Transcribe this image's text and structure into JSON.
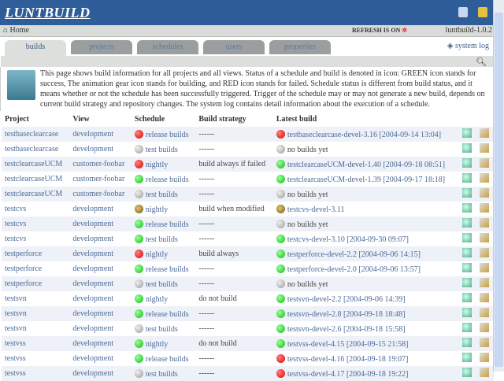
{
  "app": {
    "title": "LUNTBUILD",
    "version": "luntbuild-1.0.2",
    "refresh": "REFRESH IS ON",
    "home": "Home"
  },
  "tabs": [
    {
      "label": "builds"
    },
    {
      "label": "projects"
    },
    {
      "label": "schedules"
    },
    {
      "label": "users"
    },
    {
      "label": "properties"
    }
  ],
  "system_log": "system log",
  "description": "This page shows build information for all projects and all views. Status of a schedule and build is denoted in icon: GREEN icon stands for success, The animation gear icon stands for building, and RED icon stands for failed. Schedule status is different from build status, and it means whether or not the schedule has been successfully triggered. Trigger of the schedule may or may not generate a new build, depends on current build strategy and repository changes. The system log contains detail information about the execution of a schedule.",
  "columns": [
    "Project",
    "View",
    "Schedule",
    "Build strategy",
    "Latest build"
  ],
  "rows": [
    {
      "project": "testbaseclearcase",
      "view": "development",
      "sched_status": "red",
      "schedule": "release builds",
      "strategy": "------",
      "build_status": "red",
      "build": "testbaseclearcase-devel-3.16 [2004-09-14 13:04]"
    },
    {
      "project": "testbaseclearcase",
      "view": "development",
      "sched_status": "grey",
      "schedule": "test builds",
      "strategy": "------",
      "build_status": "grey",
      "build": "no builds yet"
    },
    {
      "project": "testclearcaseUCM",
      "view": "customer-foobar",
      "sched_status": "red",
      "schedule": "nightly",
      "strategy": "build always if failed",
      "build_status": "green",
      "build": "testclearcaseUCM-devel-1.40 [2004-09-18 08:51]"
    },
    {
      "project": "testclearcaseUCM",
      "view": "customer-foobar",
      "sched_status": "green",
      "schedule": "release builds",
      "strategy": "------",
      "build_status": "green",
      "build": "testclearcaseUCM-devel-1.39 [2004-09-17 18:18]"
    },
    {
      "project": "testclearcaseUCM",
      "view": "customer-foobar",
      "sched_status": "grey",
      "schedule": "test builds",
      "strategy": "------",
      "build_status": "grey",
      "build": "no builds yet"
    },
    {
      "project": "testcvs",
      "view": "development",
      "sched_status": "gear",
      "schedule": "nightly",
      "strategy": "build when modified",
      "build_status": "gear",
      "build": "testcvs-devel-3.11"
    },
    {
      "project": "testcvs",
      "view": "development",
      "sched_status": "green",
      "schedule": "release builds",
      "strategy": "------",
      "build_status": "grey",
      "build": "no builds yet"
    },
    {
      "project": "testcvs",
      "view": "development",
      "sched_status": "green",
      "schedule": "test builds",
      "strategy": "------",
      "build_status": "green",
      "build": "testcvs-devel-3.10 [2004-09-30 09:07]"
    },
    {
      "project": "testperforce",
      "view": "development",
      "sched_status": "red",
      "schedule": "nightly",
      "strategy": "build always",
      "build_status": "green",
      "build": "testperforce-devel-2.2 [2004-09-06 14:15]"
    },
    {
      "project": "testperforce",
      "view": "development",
      "sched_status": "green",
      "schedule": "release builds",
      "strategy": "------",
      "build_status": "green",
      "build": "testperforce-devel-2.0 [2004-09-06 13:57]"
    },
    {
      "project": "testperforce",
      "view": "development",
      "sched_status": "grey",
      "schedule": "test builds",
      "strategy": "------",
      "build_status": "grey",
      "build": "no builds yet"
    },
    {
      "project": "testsvn",
      "view": "development",
      "sched_status": "green",
      "schedule": "nightly",
      "strategy": "do not build",
      "build_status": "green",
      "build": "testsvn-devel-2.2 [2004-09-06 14:39]"
    },
    {
      "project": "testsvn",
      "view": "development",
      "sched_status": "green",
      "schedule": "release builds",
      "strategy": "------",
      "build_status": "green",
      "build": "testsvn-devel-2.8 [2004-09-18 18:48]"
    },
    {
      "project": "testsvn",
      "view": "development",
      "sched_status": "grey",
      "schedule": "test builds",
      "strategy": "------",
      "build_status": "green",
      "build": "testsvn-devel-2.6 [2004-09-18 15:58]"
    },
    {
      "project": "testvss",
      "view": "development",
      "sched_status": "green",
      "schedule": "nightly",
      "strategy": "do not build",
      "build_status": "green",
      "build": "testvss-devel-4.15 [2004-09-15 21:58]"
    },
    {
      "project": "testvss",
      "view": "development",
      "sched_status": "green",
      "schedule": "release builds",
      "strategy": "------",
      "build_status": "red",
      "build": "testvss-devel-4.16 [2004-09-18 19:07]"
    },
    {
      "project": "testvss",
      "view": "development",
      "sched_status": "grey",
      "schedule": "test builds",
      "strategy": "------",
      "build_status": "red",
      "build": "testvss-devel-4.17 [2004-09-18 19:22]"
    }
  ]
}
